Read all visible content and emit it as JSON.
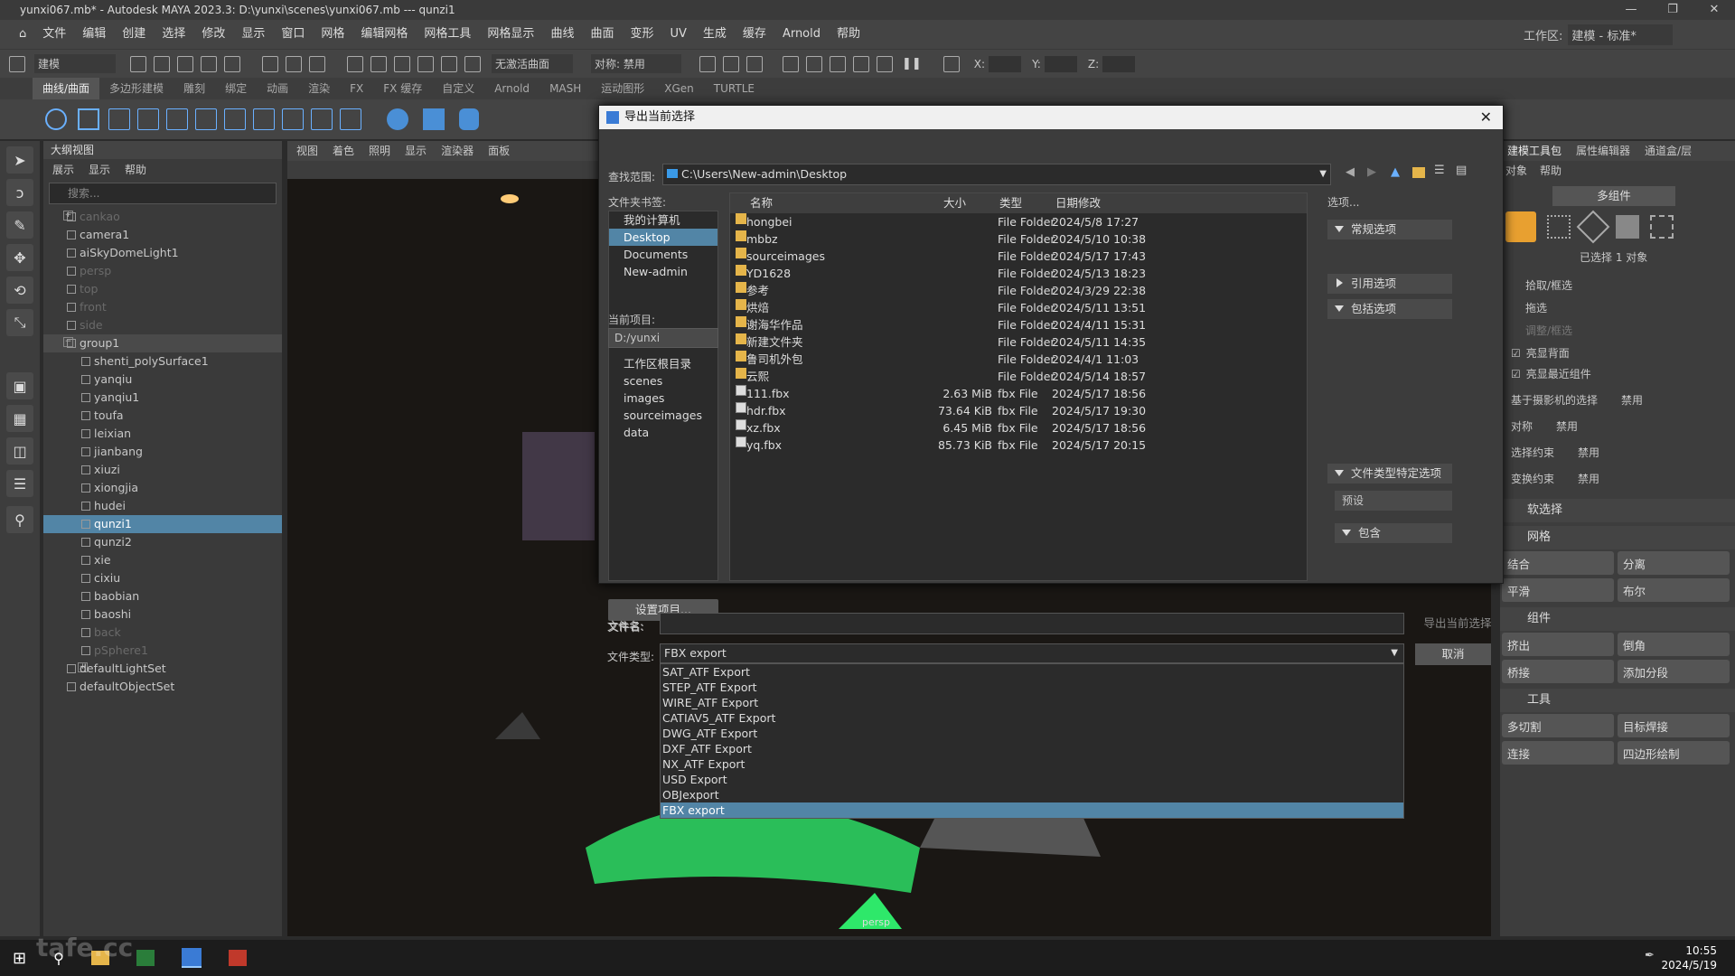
{
  "window": {
    "title": "yunxi067.mb* - Autodesk MAYA 2023.3: D:\\yunxi\\scenes\\yunxi067.mb   ---   qunzi1"
  },
  "menubar": {
    "items": [
      "文件",
      "编辑",
      "创建",
      "选择",
      "修改",
      "显示",
      "窗口",
      "网格",
      "编辑网格",
      "网格工具",
      "网格显示",
      "曲线",
      "曲面",
      "变形",
      "UV",
      "生成",
      "缓存",
      "Arnold",
      "帮助"
    ],
    "workspace_label": "工作区:",
    "workspace_value": "建模 - 标准*"
  },
  "toolbar": {
    "mode": "建模",
    "live_surface": "无激活曲面",
    "symmetry": "对称: 禁用",
    "x_label": "X:",
    "y_label": "Y:",
    "z_label": "Z:"
  },
  "shelf_tabs": [
    "曲线/曲面",
    "多边形建模",
    "雕刻",
    "绑定",
    "动画",
    "渲染",
    "FX",
    "FX 缓存",
    "自定义",
    "Arnold",
    "MASH",
    "运动图形",
    "XGen",
    "TURTLE"
  ],
  "outliner": {
    "title": "大纲视图",
    "menu": [
      "展示",
      "显示",
      "帮助"
    ],
    "search_placeholder": "搜索...",
    "items": [
      {
        "name": "cankao",
        "state": "dim"
      },
      {
        "name": "camera1",
        "state": ""
      },
      {
        "name": "aiSkyDomeLight1",
        "state": ""
      },
      {
        "name": "persp",
        "state": "dim"
      },
      {
        "name": "top",
        "state": "dim"
      },
      {
        "name": "front",
        "state": "dim"
      },
      {
        "name": "side",
        "state": "dim"
      },
      {
        "name": "group1",
        "state": "grp"
      },
      {
        "name": "shenti_polySurface1",
        "state": ""
      },
      {
        "name": "yanqiu",
        "state": ""
      },
      {
        "name": "yanqiu1",
        "state": ""
      },
      {
        "name": "toufa",
        "state": ""
      },
      {
        "name": "leixian",
        "state": ""
      },
      {
        "name": "jianbang",
        "state": ""
      },
      {
        "name": "xiuzi",
        "state": ""
      },
      {
        "name": "xiongjia",
        "state": ""
      },
      {
        "name": "hudei",
        "state": ""
      },
      {
        "name": "qunzi1",
        "state": "sel"
      },
      {
        "name": "qunzi2",
        "state": ""
      },
      {
        "name": "xie",
        "state": ""
      },
      {
        "name": "cixiu",
        "state": ""
      },
      {
        "name": "baobian",
        "state": ""
      },
      {
        "name": "baoshi",
        "state": ""
      },
      {
        "name": "back",
        "state": "dim"
      },
      {
        "name": "pSphere1",
        "state": "dim"
      },
      {
        "name": "defaultLightSet",
        "state": ""
      },
      {
        "name": "defaultObjectSet",
        "state": ""
      }
    ]
  },
  "viewport": {
    "menu": [
      "视图",
      "着色",
      "照明",
      "显示",
      "渲染器",
      "面板"
    ],
    "camera_label": "persp"
  },
  "dialog": {
    "title": "导出当前选择",
    "look_in_label": "查找范围:",
    "look_in_path": "C:\\Users\\New-admin\\Desktop",
    "bookmarks_label": "文件夹书签:",
    "bookmarks": [
      "我的计算机",
      "Desktop",
      "Documents",
      "New-admin"
    ],
    "current_project_label": "当前项目:",
    "current_project": "D:/yunxi",
    "project_folders": [
      "工作区根目录",
      "scenes",
      "images",
      "sourceimages",
      "data"
    ],
    "set_project": "设置项目...",
    "columns": {
      "name": "名称",
      "size": "大小",
      "type": "类型",
      "modified": "日期修改"
    },
    "files": [
      {
        "name": "hongbei",
        "size": "",
        "type": "File Folder",
        "date": "2024/5/8 17:27",
        "kind": "folder"
      },
      {
        "name": "mbbz",
        "size": "",
        "type": "File Folder",
        "date": "2024/5/10 10:38",
        "kind": "folder"
      },
      {
        "name": "sourceimages",
        "size": "",
        "type": "File Folder",
        "date": "2024/5/17 17:43",
        "kind": "folder"
      },
      {
        "name": "YD1628",
        "size": "",
        "type": "File Folder",
        "date": "2024/5/13 18:23",
        "kind": "folder"
      },
      {
        "name": "参考",
        "size": "",
        "type": "File Folder",
        "date": "2024/3/29 22:38",
        "kind": "folder"
      },
      {
        "name": "烘焙",
        "size": "",
        "type": "File Folder",
        "date": "2024/5/11 13:51",
        "kind": "folder"
      },
      {
        "name": "谢海华作品",
        "size": "",
        "type": "File Folder",
        "date": "2024/4/11 15:31",
        "kind": "folder"
      },
      {
        "name": "新建文件夹",
        "size": "",
        "type": "File Folder",
        "date": "2024/5/11 14:35",
        "kind": "folder"
      },
      {
        "name": "鲁司机外包",
        "size": "",
        "type": "File Folder",
        "date": "2024/4/1 11:03",
        "kind": "folder"
      },
      {
        "name": "云熙",
        "size": "",
        "type": "File Folder",
        "date": "2024/5/14 18:57",
        "kind": "folder"
      },
      {
        "name": "111.fbx",
        "size": "2.63 MiB",
        "type": "fbx File",
        "date": "2024/5/17 18:56",
        "kind": "file"
      },
      {
        "name": "hdr.fbx",
        "size": "73.64 KiB",
        "type": "fbx File",
        "date": "2024/5/17 19:30",
        "kind": "file"
      },
      {
        "name": "xz.fbx",
        "size": "6.45 MiB",
        "type": "fbx File",
        "date": "2024/5/17 18:56",
        "kind": "file"
      },
      {
        "name": "yq.fbx",
        "size": "85.73 KiB",
        "type": "fbx File",
        "date": "2024/5/17 20:15",
        "kind": "file"
      }
    ],
    "options_label": "选项...",
    "option_sections": [
      {
        "label": "常规选项",
        "open": true
      },
      {
        "label": "引用选项",
        "open": false
      },
      {
        "label": "包括选项",
        "open": true
      },
      {
        "label": "文件类型特定选项",
        "open": true
      }
    ],
    "preset_label": "预设",
    "include_label": "包含",
    "filename_label": "文件名:",
    "filename_value": "",
    "filetype_label": "文件类型:",
    "filetype_value": "FBX export",
    "export_button": "导出当前选择",
    "cancel_button": "取消",
    "filetype_options": [
      "SAT_ATF Export",
      "STEP_ATF Export",
      "WIRE_ATF Export",
      "CATIAV5_ATF Export",
      "DWG_ATF Export",
      "DXF_ATF Export",
      "NX_ATF Export",
      "USD Export",
      "OBJexport",
      "FBX export"
    ],
    "filetype_selected_index": 9
  },
  "right_panel": {
    "tabs": [
      "建模工具包",
      "属性编辑器",
      "通道盒/层"
    ],
    "menu": [
      "对象",
      "帮助"
    ],
    "multi_component": "多组件",
    "selected_info": "已选择 1 对象",
    "pick_options": [
      "拾取/框选",
      "拖选",
      "调整/框选"
    ],
    "checks": [
      "亮显背面",
      "亮显最近组件"
    ],
    "camera_select": "基于摄影机的选择",
    "camera_select_value": "禁用",
    "symmetry": "对称",
    "symmetry_value": "禁用",
    "select_constraint": "选择约束",
    "select_constraint_value": "禁用",
    "transform_constraint": "变换约束",
    "transform_constraint_value": "禁用",
    "soft_select": "软选择",
    "mesh_section": "网格",
    "mesh_buttons": [
      "结合",
      "分离",
      "平滑",
      "布尔"
    ],
    "component_section": "组件",
    "component_buttons": [
      "挤出",
      "倒角",
      "桥接",
      "添加分段"
    ],
    "tools_section": "工具",
    "tool_buttons": [
      "多切割",
      "目标焊接",
      "连接",
      "四边形绘制"
    ]
  },
  "taskbar": {
    "time": "10:55",
    "date": "2024/5/19"
  },
  "watermark": "tafe.cc"
}
